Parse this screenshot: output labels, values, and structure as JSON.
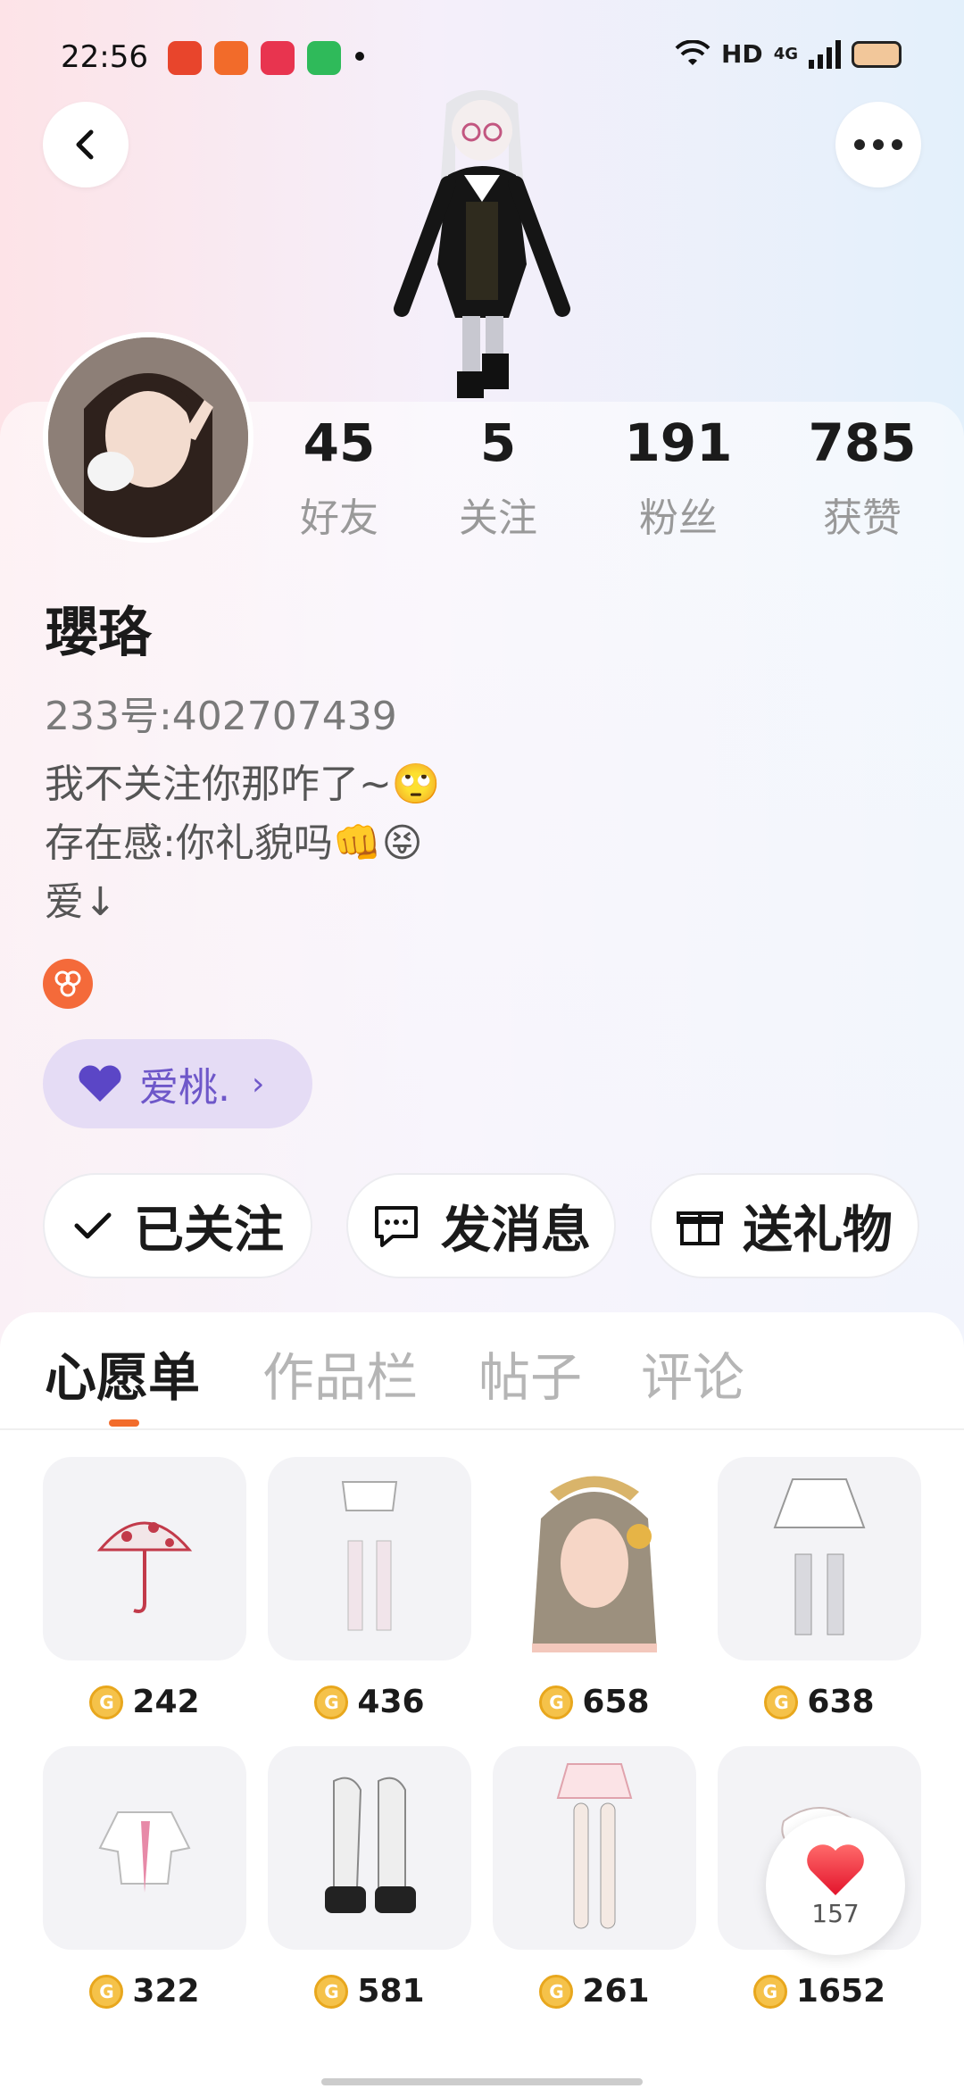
{
  "status_bar": {
    "time": "22:56",
    "network": "HD",
    "signal_type": "4G",
    "notification_apps": [
      "taobao-app-icon",
      "taobao-special-app-icon",
      "music-app-icon",
      "store-app-icon"
    ]
  },
  "profile": {
    "username": "瓔珞",
    "user_id": "233号:402707439",
    "bio_lines": [
      "我不关注你那咋了~🙄",
      "存在感:你礼貌吗👊😝",
      "爱↓"
    ],
    "cp_label": "爱桃.",
    "stats": [
      {
        "value": "45",
        "label": "好友"
      },
      {
        "value": "5",
        "label": "关注"
      },
      {
        "value": "191",
        "label": "粉丝"
      },
      {
        "value": "785",
        "label": "获赞"
      }
    ]
  },
  "actions": {
    "follow": "已关注",
    "message": "发消息",
    "gift": "送礼物"
  },
  "tabs": [
    "心愿单",
    "作品栏",
    "帖子",
    "评论"
  ],
  "wishlist": [
    {
      "icon": "umbrella-item",
      "price": "242"
    },
    {
      "icon": "skirt-stockings-item",
      "price": "436"
    },
    {
      "icon": "hairstyle-item",
      "price": "658"
    },
    {
      "icon": "white-skirt-item",
      "price": "638"
    },
    {
      "icon": "blouse-item",
      "price": "322"
    },
    {
      "icon": "boots-item",
      "price": "581"
    },
    {
      "icon": "pink-skirt-item",
      "price": "261"
    },
    {
      "icon": "lace-item",
      "price": "1652"
    }
  ],
  "like_fab": {
    "count": "157"
  },
  "colors": {
    "accent": "#f26b2a",
    "cp_purple": "#6e57c9",
    "coin": "#f5c24a"
  }
}
